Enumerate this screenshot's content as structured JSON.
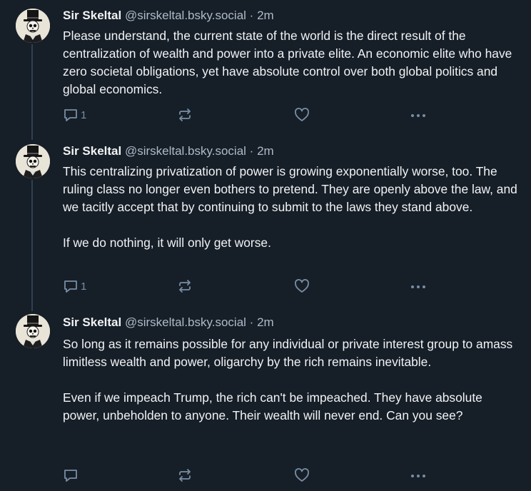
{
  "posts": [
    {
      "author_name": "Sir Skeltal",
      "handle": "@sirskeltal.bsky.social",
      "separator": "·",
      "time": "2m",
      "paragraphs": [
        "Please understand, the current state of the world is the direct result of the centralization of wealth and power into a private elite. An economic elite who have zero societal obligations, yet have absolute control over both global politics and global economics."
      ],
      "reply_count": "1"
    },
    {
      "author_name": "Sir Skeltal",
      "handle": "@sirskeltal.bsky.social",
      "separator": "·",
      "time": "2m",
      "paragraphs": [
        "This centralizing privatization of power is growing exponentially worse, too. The ruling class no longer even bothers to pretend. They are openly above the law, and we tacitly accept that by continuing to submit to the laws they stand above.",
        "If we do nothing, it will only get worse."
      ],
      "reply_count": "1"
    },
    {
      "author_name": "Sir Skeltal",
      "handle": "@sirskeltal.bsky.social",
      "separator": "·",
      "time": "2m",
      "paragraphs": [
        "So long as it remains possible for any individual or private interest group to amass limitless wealth and power, oligarchy by the rich remains inevitable.",
        "Even if we impeach Trump, the rich can't be impeached. They have absolute power, unbeholden to anyone. Their wealth will never end. Can you see?"
      ],
      "reply_count": ""
    }
  ],
  "icons": {
    "reply": "reply-icon",
    "repost": "repost-icon",
    "like": "like-icon",
    "more": "more-options-icon",
    "avatar": "skeleton-top-hat-avatar"
  },
  "colors": {
    "background": "#161e27",
    "text": "#f1f3f5",
    "secondary_text": "#aebbc9",
    "icon": "#788ea5",
    "thread_line": "#2e4052"
  }
}
